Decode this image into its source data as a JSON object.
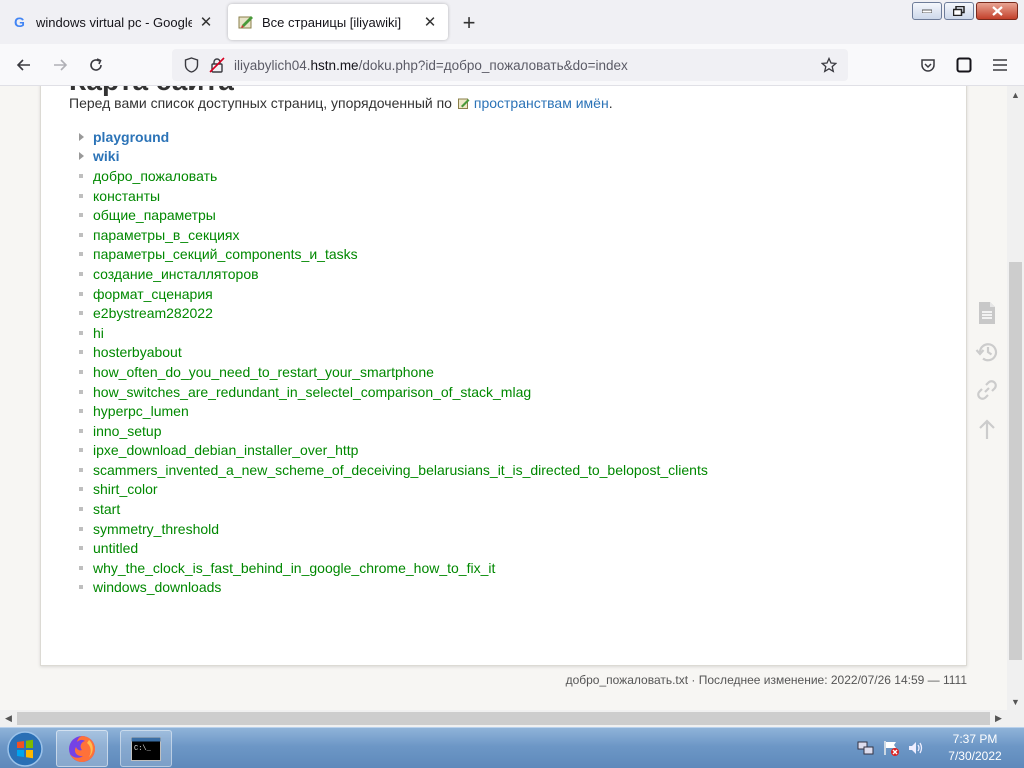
{
  "browser": {
    "tabs": [
      {
        "title": "windows virtual pc - Google Sea",
        "favicon": "google-icon",
        "active": false
      },
      {
        "title": "Все страницы [iliyawiki]",
        "favicon": "dokuwiki-icon",
        "active": true
      }
    ],
    "url": {
      "prefix": "iliyabylich04.",
      "domain": "hstn.me",
      "path": "/doku.php?id=добро_пожаловать&do=index"
    }
  },
  "page": {
    "heading": "Карта сайта",
    "intro_text": "Перед вами список доступных страниц, упорядоченный по",
    "intro_link": "пространствам имён",
    "intro_end": ".",
    "namespaces": [
      "playground",
      "wiki"
    ],
    "pages": [
      "добро_пожаловать",
      "константы",
      "общие_параметры",
      "параметры_в_секциях",
      "параметры_секций_components_и_tasks",
      "создание_инсталляторов",
      "формат_сценария",
      "e2bystream282022",
      "hi",
      "hosterbyabout",
      "how_often_do_you_need_to_restart_your_smartphone",
      "how_switches_are_redundant_in_selectel_comparison_of_stack_mlag",
      "hyperpc_lumen",
      "inno_setup",
      "ipxe_download_debian_installer_over_http",
      "scammers_invented_a_new_scheme_of_deceiving_belarusians_it_is_directed_to_belopost_clients",
      "shirt_color",
      "start",
      "symmetry_threshold",
      "untitled",
      "why_the_clock_is_fast_behind_in_google_chrome_how_to_fix_it",
      "windows_downloads"
    ],
    "footer": "добро_пожаловать.txt · Последнее изменение: 2022/07/26 14:59 — 1111"
  },
  "taskbar": {
    "time": "7:37 PM",
    "date": "7/30/2022"
  },
  "colors": {
    "page_link": "#008800",
    "namespace_link": "#2b73b7"
  }
}
